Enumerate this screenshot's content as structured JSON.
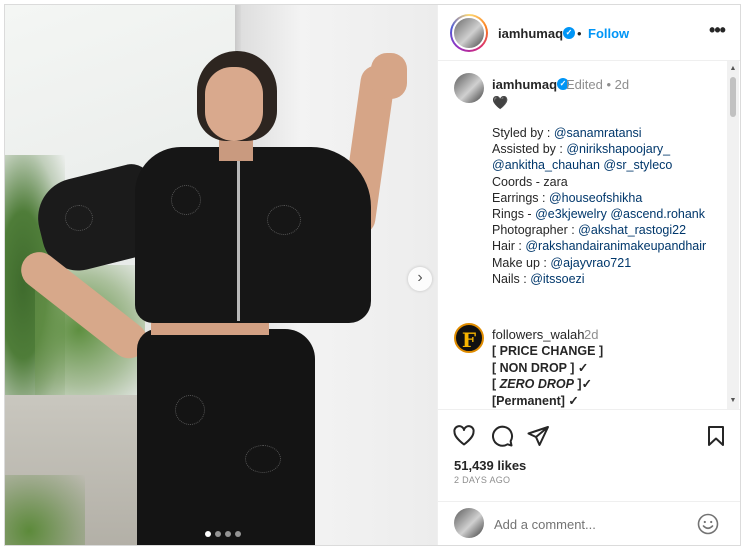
{
  "post": {
    "username": "iamhumaq",
    "verified": true,
    "follow_label": "Follow",
    "separator": "•",
    "more_label": "•••"
  },
  "caption": {
    "username": "iamhumaq",
    "meta": "Edited • 2d",
    "first_line": "🖤",
    "lines": [
      [
        {
          "t": "Styled by : "
        },
        {
          "t": "@sanamratansi",
          "m": true
        }
      ],
      [
        {
          "t": "Assisted by : "
        },
        {
          "t": "@nirikshapoojary_",
          "m": true
        }
      ],
      [
        {
          "t": "@ankitha_chauhan",
          "m": true
        },
        {
          "t": " "
        },
        {
          "t": "@sr_styleco",
          "m": true
        }
      ],
      [
        {
          "t": "Coords - zara"
        }
      ],
      [
        {
          "t": "Earrings : "
        },
        {
          "t": "@houseofshikha",
          "m": true
        }
      ],
      [
        {
          "t": "Rings - "
        },
        {
          "t": "@e3kjewelry",
          "m": true
        },
        {
          "t": " "
        },
        {
          "t": "@ascend.rohank",
          "m": true
        }
      ],
      [
        {
          "t": "Photographer : "
        },
        {
          "t": "@akshat_rastogi22",
          "m": true
        }
      ],
      [
        {
          "t": "Hair : "
        },
        {
          "t": "@rakshandairanimakeupandhair",
          "m": true
        }
      ],
      [
        {
          "t": "Make up : "
        },
        {
          "t": "@ajayvrao721",
          "m": true
        }
      ],
      [
        {
          "t": "Nails : "
        },
        {
          "t": "@itssoezi",
          "m": true
        }
      ]
    ]
  },
  "comment2": {
    "username": "followers_walah",
    "time": "2d",
    "avatar_letter": "F",
    "lines": [
      {
        "prefix": "[ ",
        "text": "PRICE CHANGE",
        "suffix": " ]",
        "italic": false
      },
      {
        "prefix": "[ ",
        "text": "NON DROP",
        "suffix": " ] ✓",
        "italic": false
      },
      {
        "prefix": "[ ",
        "text": "ZERO DROP",
        "suffix": " ]✓",
        "italic": true
      },
      {
        "prefix": "[",
        "text": "Permanent",
        "suffix": "] ✓",
        "italic": false
      }
    ]
  },
  "stats": {
    "likes": "51,439 likes",
    "posted": "2 DAYS AGO"
  },
  "add_comment": {
    "placeholder": "Add a comment..."
  },
  "carousel": {
    "slide_count": 4,
    "active_index": 0,
    "next_label": "›"
  },
  "icons": [
    "verified-badge-icon",
    "more-options-icon",
    "heart-icon",
    "comment-icon",
    "share-icon",
    "bookmark-icon",
    "emoji-icon",
    "chevron-right-icon"
  ],
  "colors": {
    "accent": "#0095f6",
    "mention": "#00376b",
    "muted": "#8e8e8e",
    "text": "#262626"
  }
}
